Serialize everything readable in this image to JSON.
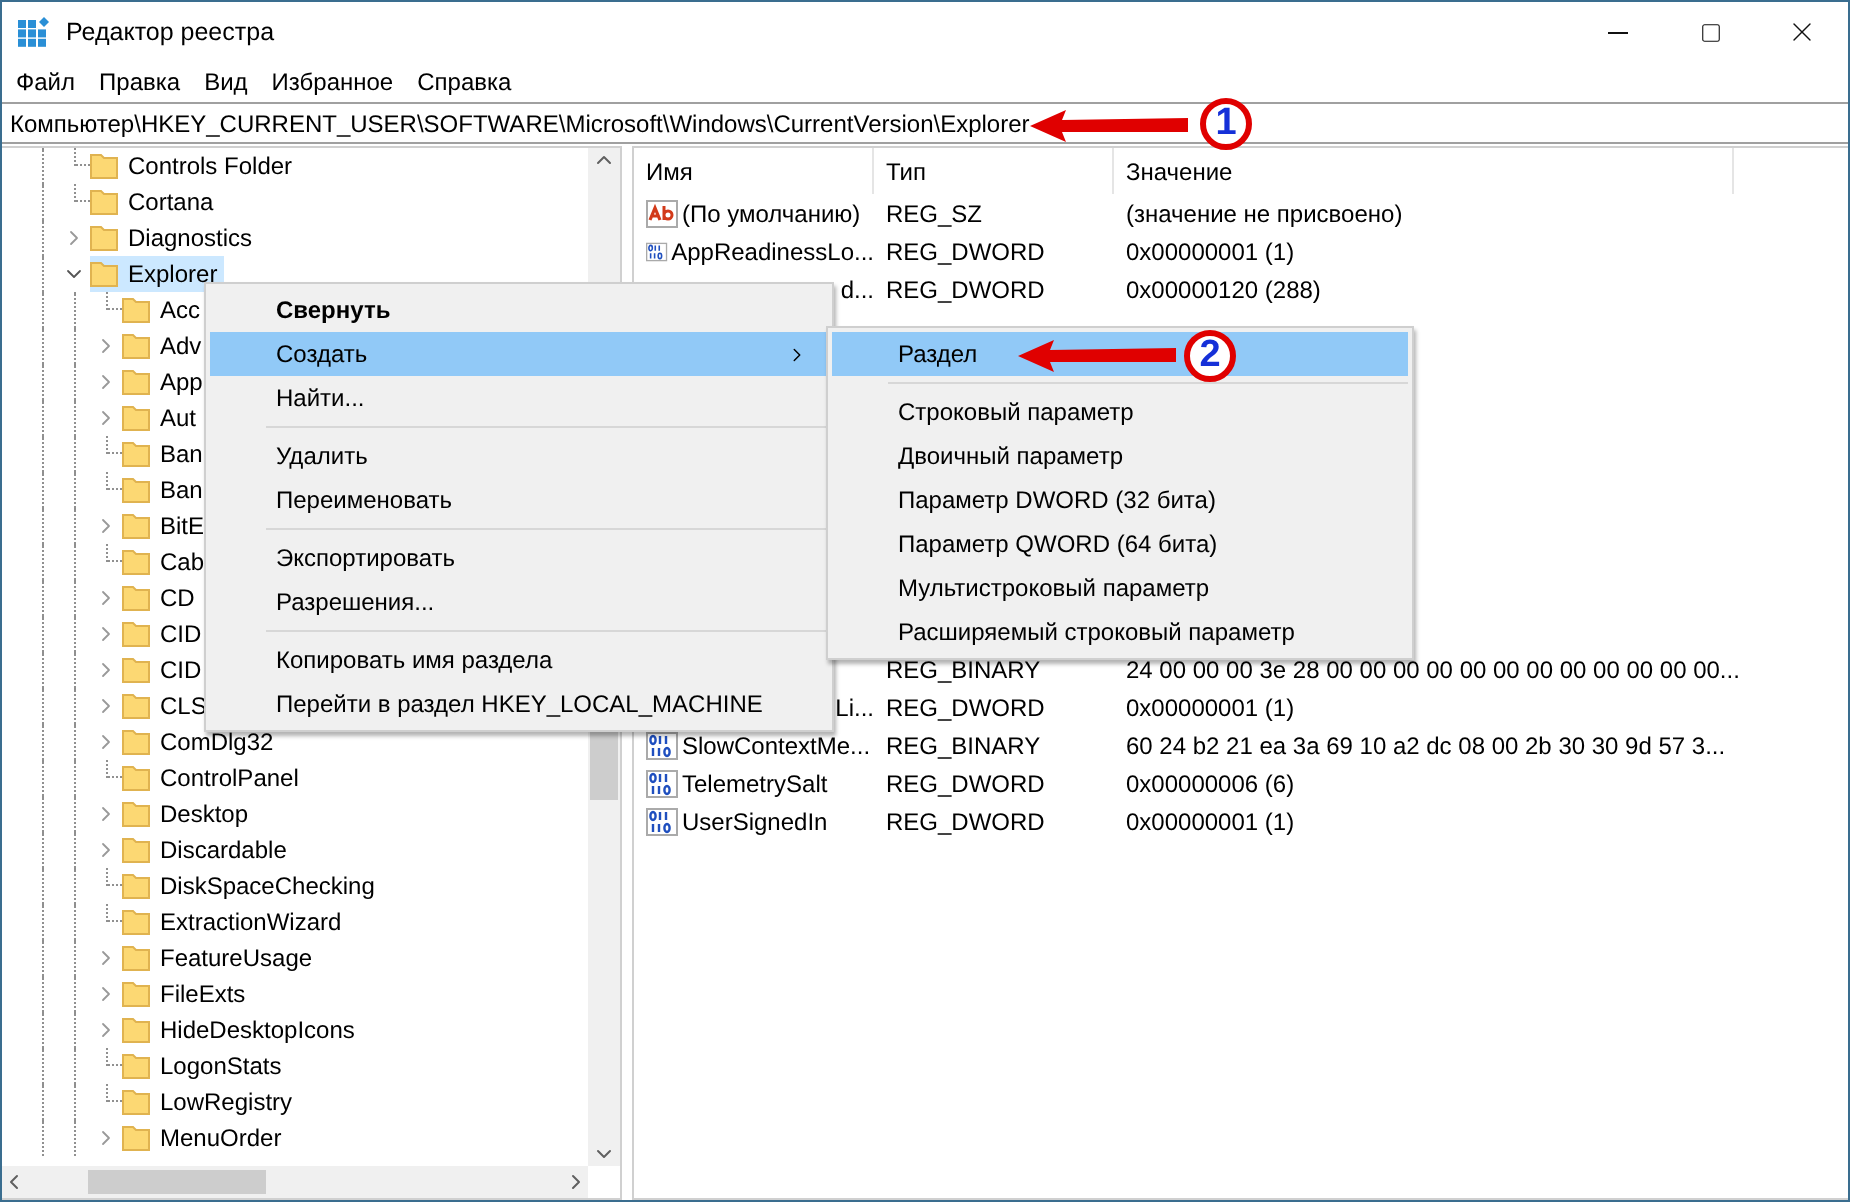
{
  "window": {
    "title": "Редактор реестра"
  },
  "menu_bar": [
    "Файл",
    "Правка",
    "Вид",
    "Избранное",
    "Справка"
  ],
  "address": "Компьютер\\HKEY_CURRENT_USER\\SOFTWARE\\Microsoft\\Windows\\CurrentVersion\\Explorer",
  "tree": [
    {
      "label": "Controls Folder",
      "expandable": false,
      "selected": false
    },
    {
      "label": "Cortana",
      "expandable": false,
      "selected": false
    },
    {
      "label": "Diagnostics",
      "expandable": true,
      "expanded": false,
      "selected": false
    },
    {
      "label": "Explorer",
      "expandable": true,
      "expanded": true,
      "selected": true,
      "children": [
        {
          "label": "Acc",
          "expandable": false,
          "selected": false
        },
        {
          "label": "Adv",
          "expandable": true,
          "expanded": false,
          "selected": false
        },
        {
          "label": "App",
          "expandable": true,
          "expanded": false,
          "selected": false
        },
        {
          "label": "Aut",
          "expandable": true,
          "expanded": false,
          "selected": false
        },
        {
          "label": "Ban",
          "expandable": false,
          "selected": false
        },
        {
          "label": "Ban",
          "expandable": false,
          "selected": false
        },
        {
          "label": "BitE",
          "expandable": true,
          "expanded": false,
          "selected": false
        },
        {
          "label": "Cab",
          "expandable": false,
          "selected": false
        },
        {
          "label": "CD",
          "expandable": true,
          "expanded": false,
          "selected": false
        },
        {
          "label": "CID",
          "expandable": true,
          "expanded": false,
          "selected": false
        },
        {
          "label": "CID",
          "expandable": true,
          "expanded": false,
          "selected": false
        },
        {
          "label": "CLS",
          "expandable": true,
          "expanded": false,
          "selected": false
        },
        {
          "label": "ComDlg32",
          "expandable": true,
          "expanded": false,
          "selected": false
        },
        {
          "label": "ControlPanel",
          "expandable": false,
          "selected": false
        },
        {
          "label": "Desktop",
          "expandable": true,
          "expanded": false,
          "selected": false
        },
        {
          "label": "Discardable",
          "expandable": true,
          "expanded": false,
          "selected": false
        },
        {
          "label": "DiskSpaceChecking",
          "expandable": false,
          "selected": false
        },
        {
          "label": "ExtractionWizard",
          "expandable": false,
          "selected": false
        },
        {
          "label": "FeatureUsage",
          "expandable": true,
          "expanded": false,
          "selected": false
        },
        {
          "label": "FileExts",
          "expandable": true,
          "expanded": false,
          "selected": false
        },
        {
          "label": "HideDesktopIcons",
          "expandable": true,
          "expanded": false,
          "selected": false
        },
        {
          "label": "LogonStats",
          "expandable": false,
          "selected": false
        },
        {
          "label": "LowRegistry",
          "expandable": false,
          "selected": false
        },
        {
          "label": "MenuOrder",
          "expandable": true,
          "expanded": false,
          "selected": false
        }
      ]
    }
  ],
  "columns": [
    "Имя",
    "Тип",
    "Значение"
  ],
  "values": [
    {
      "kind": "string",
      "name": "(По умолчанию)",
      "type": "REG_SZ",
      "data": "(значение не присвоено)"
    },
    {
      "kind": "binary",
      "name": "AppReadinessLo...",
      "type": "REG_DWORD",
      "data": "0x00000001 (1)"
    },
    {
      "kind": "clipped",
      "name": "d...",
      "type": "REG_DWORD",
      "data": "0x00000120 (288)"
    },
    {
      "kind": "covered"
    },
    {
      "kind": "covered"
    },
    {
      "kind": "covered"
    },
    {
      "kind": "covered"
    },
    {
      "kind": "covered"
    },
    {
      "kind": "covered"
    },
    {
      "kind": "covered"
    },
    {
      "kind": "covered"
    },
    {
      "kind": "covered"
    },
    {
      "kind": "clipped",
      "type": "REG_BINARY",
      "data": "24 00 00 00 3e 28 00 00 00 00 00 00 00 00 00 00 00 00..."
    },
    {
      "kind": "clipped",
      "name": "Li...",
      "type": "REG_DWORD",
      "data": "0x00000001 (1)"
    },
    {
      "kind": "binary",
      "name": "SlowContextMe...",
      "type": "REG_BINARY",
      "data": "60 24 b2 21 ea 3a 69 10 a2 dc 08 00 2b 30 30 9d 57 3..."
    },
    {
      "kind": "binary",
      "name": "TelemetrySalt",
      "type": "REG_DWORD",
      "data": "0x00000006 (6)"
    },
    {
      "kind": "binary",
      "name": "UserSignedIn",
      "type": "REG_DWORD",
      "data": "0x00000001 (1)"
    }
  ],
  "context_menu": [
    {
      "kind": "item",
      "label": "Свернуть",
      "bold": true,
      "selected": false,
      "submenu": false
    },
    {
      "kind": "item",
      "label": "Создать",
      "bold": false,
      "selected": true,
      "submenu": true
    },
    {
      "kind": "item",
      "label": "Найти...",
      "bold": false,
      "selected": false,
      "submenu": false
    },
    {
      "kind": "separator"
    },
    {
      "kind": "item",
      "label": "Удалить",
      "bold": false,
      "selected": false,
      "submenu": false
    },
    {
      "kind": "item",
      "label": "Переименовать",
      "bold": false,
      "selected": false,
      "submenu": false
    },
    {
      "kind": "separator"
    },
    {
      "kind": "item",
      "label": "Экспортировать",
      "bold": false,
      "selected": false,
      "submenu": false
    },
    {
      "kind": "item",
      "label": "Разрешения...",
      "bold": false,
      "selected": false,
      "submenu": false
    },
    {
      "kind": "separator"
    },
    {
      "kind": "item",
      "label": "Копировать имя раздела",
      "bold": false,
      "selected": false,
      "submenu": false
    },
    {
      "kind": "item",
      "label": "Перейти в раздел HKEY_LOCAL_MACHINE",
      "bold": false,
      "selected": false,
      "submenu": false
    }
  ],
  "submenu": [
    {
      "kind": "item",
      "label": "Раздел",
      "bold": false,
      "selected": true,
      "submenu": false
    },
    {
      "kind": "separator"
    },
    {
      "kind": "item",
      "label": "Строковый параметр",
      "bold": false,
      "selected": false,
      "submenu": false
    },
    {
      "kind": "item",
      "label": "Двоичный параметр",
      "bold": false,
      "selected": false,
      "submenu": false
    },
    {
      "kind": "item",
      "label": "Параметр DWORD (32 бита)",
      "bold": false,
      "selected": false,
      "submenu": false
    },
    {
      "kind": "item",
      "label": "Параметр QWORD (64 бита)",
      "bold": false,
      "selected": false,
      "submenu": false
    },
    {
      "kind": "item",
      "label": "Мультистроковый параметр",
      "bold": false,
      "selected": false,
      "submenu": false
    },
    {
      "kind": "item",
      "label": "Расширяемый строковый параметр",
      "bold": false,
      "selected": false,
      "submenu": false
    }
  ],
  "annotations": [
    {
      "label": "1"
    },
    {
      "label": "2"
    }
  ]
}
